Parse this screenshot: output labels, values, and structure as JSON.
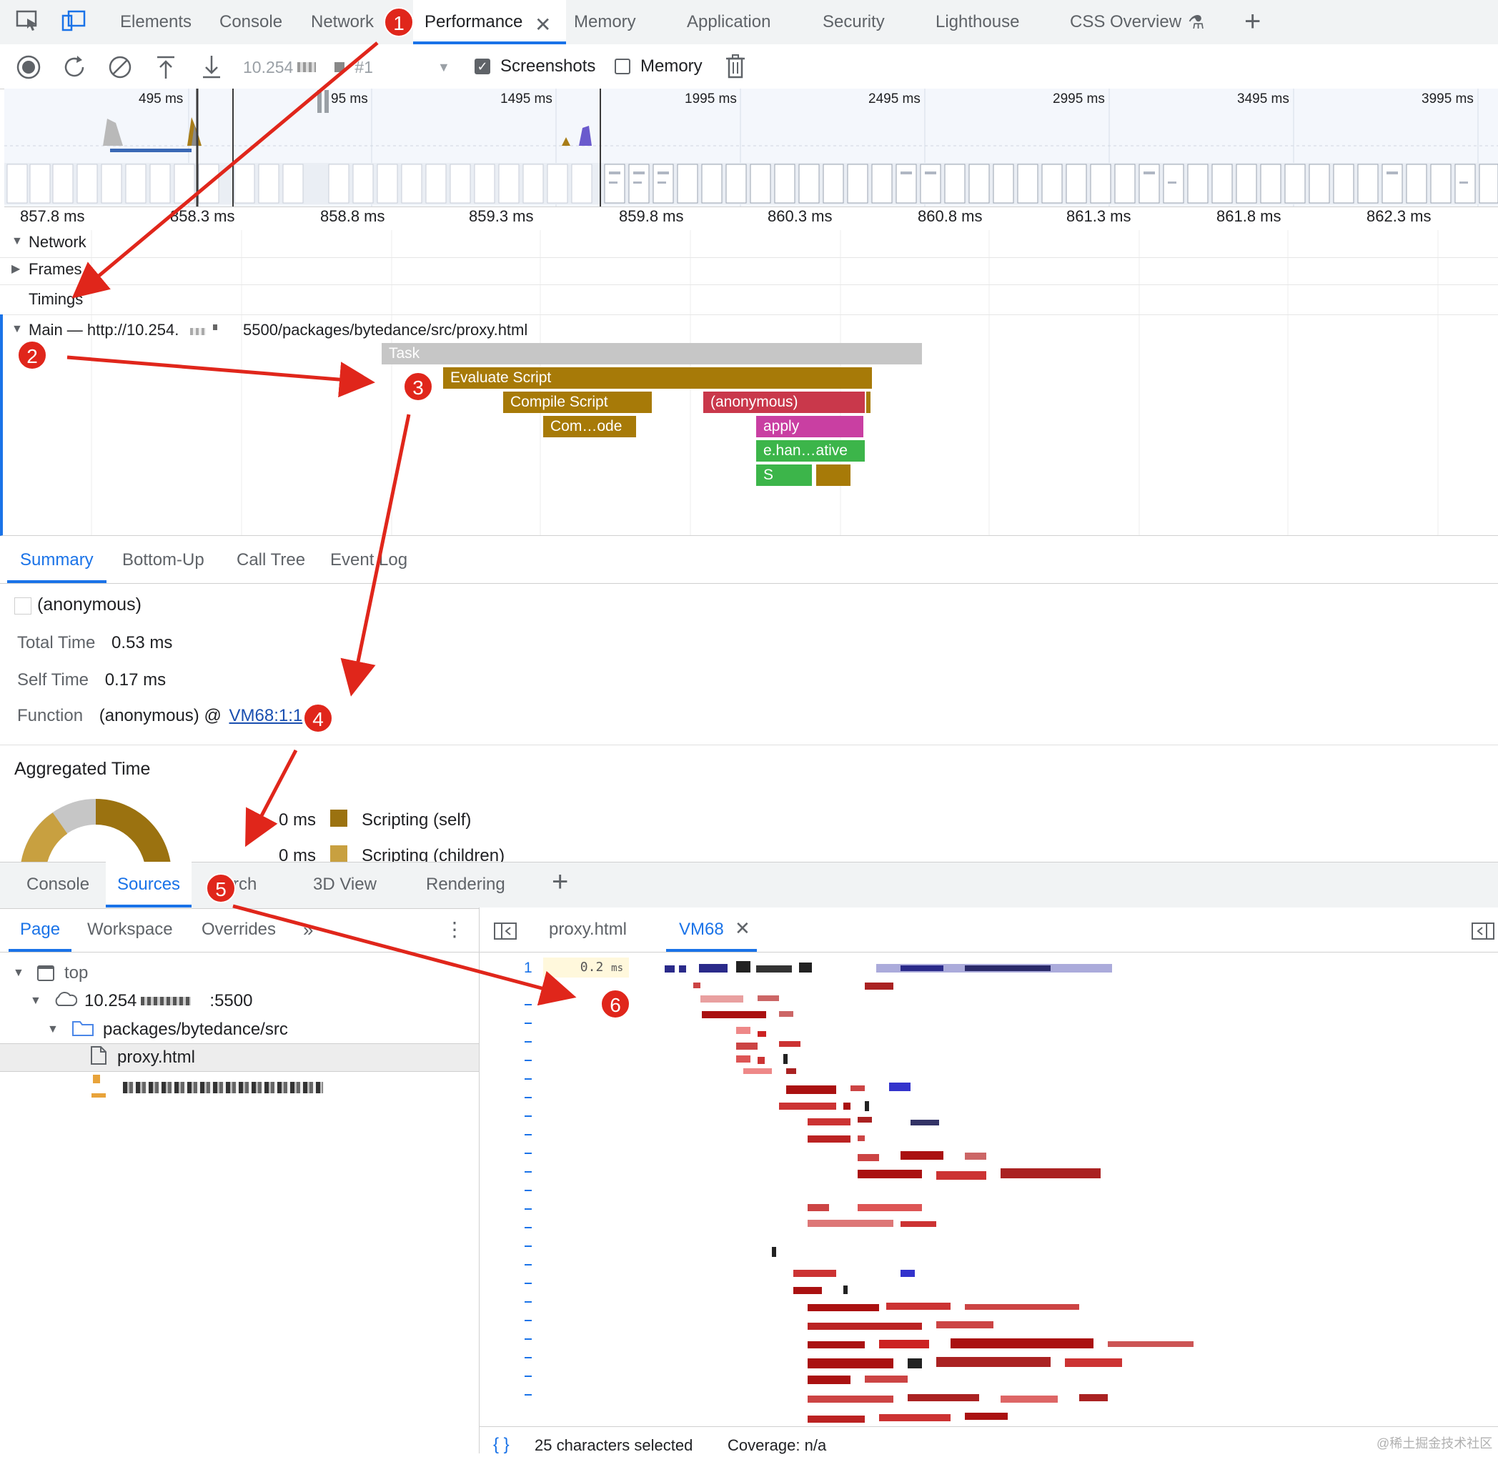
{
  "top_tabs": {
    "elements": "Elements",
    "console": "Console",
    "network": "Network",
    "performance": "Performance",
    "memory": "Memory",
    "application": "Application",
    "security": "Security",
    "lighthouse": "Lighthouse",
    "css_overview": "CSS Overview"
  },
  "toolbar": {
    "recording": "10.254",
    "recording_suffix": "#1",
    "screenshots_label": "Screenshots",
    "screenshots_checked": true,
    "memory_label": "Memory",
    "memory_checked": false
  },
  "overview": {
    "ticks": [
      "495 ms",
      "95 ms",
      "1495 ms",
      "1995 ms",
      "2495 ms",
      "2995 ms",
      "3495 ms",
      "3995 ms"
    ]
  },
  "ruler": {
    "ticks": [
      "857.8 ms",
      "858.3 ms",
      "858.8 ms",
      "859.3 ms",
      "859.8 ms",
      "860.3 ms",
      "860.8 ms",
      "861.3 ms",
      "861.8 ms",
      "862.3 ms"
    ]
  },
  "tracks": {
    "network": "Network",
    "frames": "Frames",
    "timings": "Timings",
    "main_prefix": "Main — http://10.254.",
    "main_suffix": "5500/packages/bytedance/src/proxy.html"
  },
  "flame": {
    "task": "Task",
    "evaluate_script": "Evaluate Script",
    "compile_script": "Compile Script",
    "compile_code": "Com…ode",
    "anonymous": "(anonymous)",
    "apply": "apply",
    "ehan": "e.han…ative",
    "s": "S",
    "colors": {
      "task": "#c6c6c6",
      "scripting": "#a77a08",
      "anonymous": "#c9384b",
      "apply": "#c93fa2",
      "green": "#3cb54a"
    }
  },
  "detail_tabs": {
    "summary": "Summary",
    "bottom_up": "Bottom-Up",
    "call_tree": "Call Tree",
    "event_log": "Event Log"
  },
  "summary": {
    "title": "(anonymous)",
    "total_time_label": "Total Time",
    "total_time_value": "0.53 ms",
    "self_time_label": "Self Time",
    "self_time_value": "0.17 ms",
    "function_label": "Function",
    "function_value": "(anonymous) @",
    "function_link": "VM68:1:1",
    "aggregated_title": "Aggregated Time",
    "legend": [
      {
        "value": "0 ms",
        "label": "Scripting (self)",
        "color": "#9b7210"
      },
      {
        "value": "0 ms",
        "label": "Scripting (children)",
        "color": "#c8a040"
      }
    ]
  },
  "drawer_tabs": {
    "console": "Console",
    "sources": "Sources",
    "search_partial": "rch",
    "view3d": "3D View",
    "rendering": "Rendering"
  },
  "sources_nav": {
    "page": "Page",
    "workspace": "Workspace",
    "overrides": "Overrides",
    "tree_top": "top",
    "tree_host": "10.254",
    "tree_port": ":5500",
    "tree_folder": "packages/bytedance/src",
    "tree_file": "proxy.html"
  },
  "editor": {
    "tab_proxy": "proxy.html",
    "tab_vm": "VM68",
    "line_number": "1",
    "line_timing": "0.2",
    "line_timing_unit": "ms",
    "status_braces": "{ }",
    "status_selected": "25 characters selected",
    "status_coverage": "Coverage: n/a"
  },
  "annotations": [
    "1",
    "2",
    "3",
    "4",
    "5",
    "6"
  ],
  "watermark": "@稀土掘金技术社区"
}
